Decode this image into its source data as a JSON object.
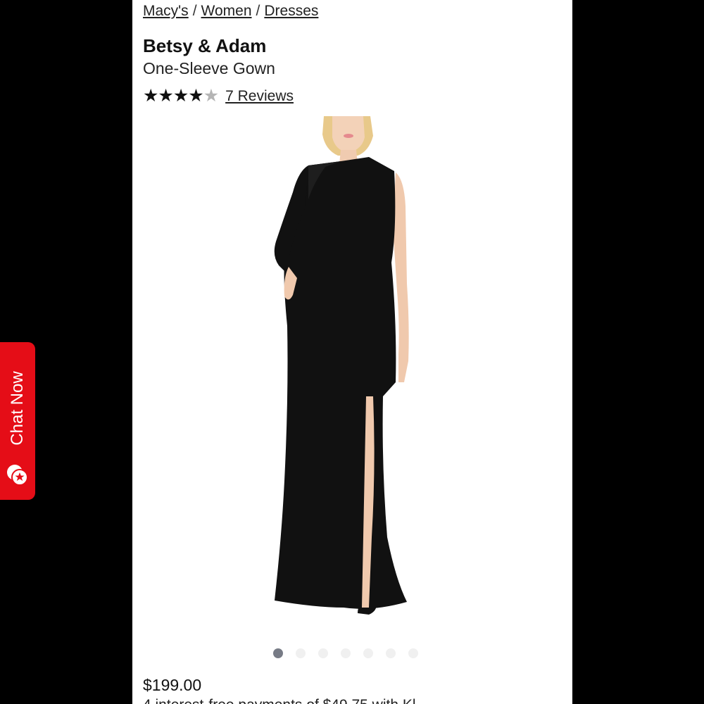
{
  "breadcrumb": {
    "items": [
      {
        "label": "Macy's"
      },
      {
        "label": "Women"
      },
      {
        "label": "Dresses"
      }
    ],
    "separator": "/"
  },
  "product": {
    "brand": "Betsy & Adam",
    "name": "One-Sleeve Gown",
    "rating": {
      "stars_filled": 4,
      "stars_total": 5,
      "reviews_label": "7 Reviews"
    },
    "dress_color": "#111111",
    "price": "$199.00",
    "installment_text": "4 interest-free payments of $49.75 with Kl"
  },
  "chat": {
    "label": "Chat Now",
    "color": "#e50d17",
    "icon": "chat-bubble-star-icon"
  },
  "carousel": {
    "image_count": 7,
    "active_index": 0
  }
}
